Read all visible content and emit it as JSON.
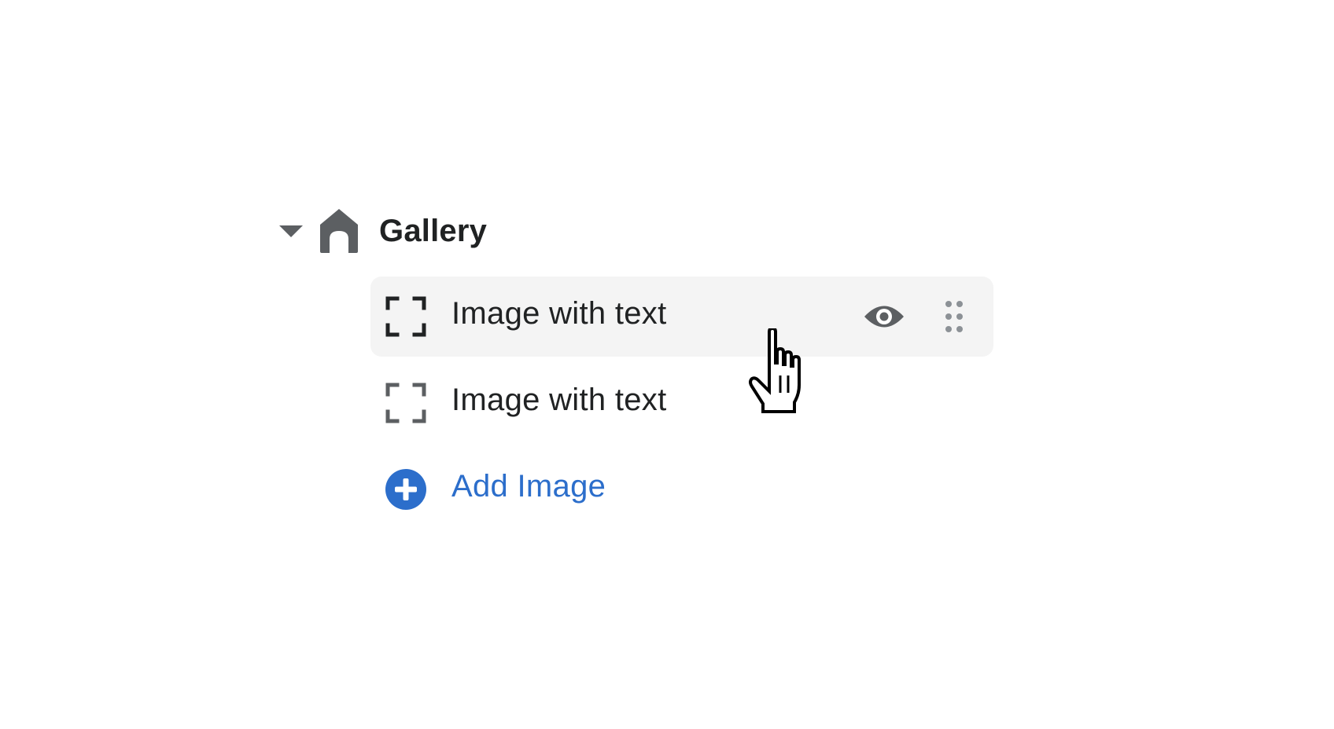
{
  "section": {
    "title": "Gallery",
    "caret_icon": "caret-down-icon",
    "icon": "section-icon",
    "icon_color": "#5c5f62"
  },
  "blocks": [
    {
      "label": "Image with text",
      "icon": "image-frame-icon",
      "state": "hover"
    },
    {
      "label": "Image with text",
      "icon": "image-frame-icon",
      "state": "default"
    }
  ],
  "row_actions": {
    "visibility_icon": "eye-icon",
    "drag_icon": "drag-handle-icon"
  },
  "add_block": {
    "label": "Add Image",
    "icon": "plus-circle-icon",
    "color": "#2c6ecb"
  },
  "colors": {
    "text": "#202223",
    "icon": "#5c5f62",
    "hover_bg": "#f4f4f4",
    "link": "#2c6ecb"
  },
  "pointer": "hand-pointer-icon"
}
